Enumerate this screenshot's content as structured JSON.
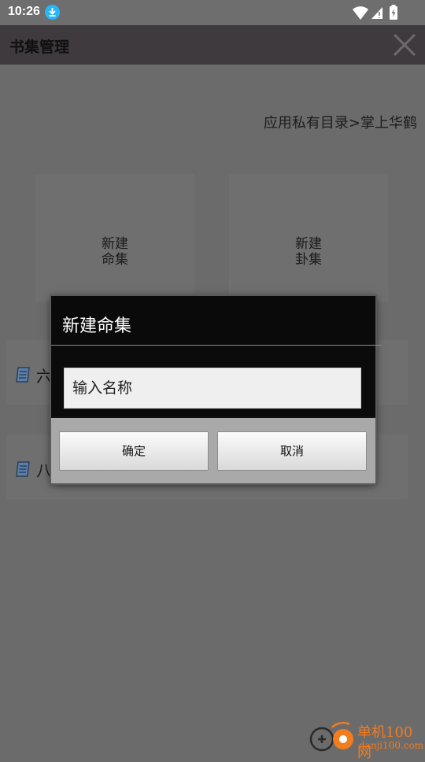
{
  "status_bar": {
    "time": "10:26"
  },
  "app_bar": {
    "title": "书集管理"
  },
  "content": {
    "path_label": "应用私有目录>掌上华鹤",
    "tiles": [
      {
        "line1": "新建",
        "line2": "命集"
      },
      {
        "line1": "新建",
        "line2": "卦集"
      }
    ],
    "rows": [
      {
        "label": "六"
      },
      {
        "label": "八"
      }
    ]
  },
  "dialog": {
    "title": "新建命集",
    "input_placeholder": "输入名称",
    "confirm_label": "确定",
    "cancel_label": "取消"
  },
  "watermark": {
    "site_name": "单机100网",
    "site_url": "danji100.com"
  },
  "colors": {
    "status_download_badge": "#29b6f6",
    "dim_background": "#6b6b6b",
    "dialog_background": "#121212",
    "dialog_footer": "#a9a9a9",
    "watermark_orange": "#f07d1e"
  }
}
